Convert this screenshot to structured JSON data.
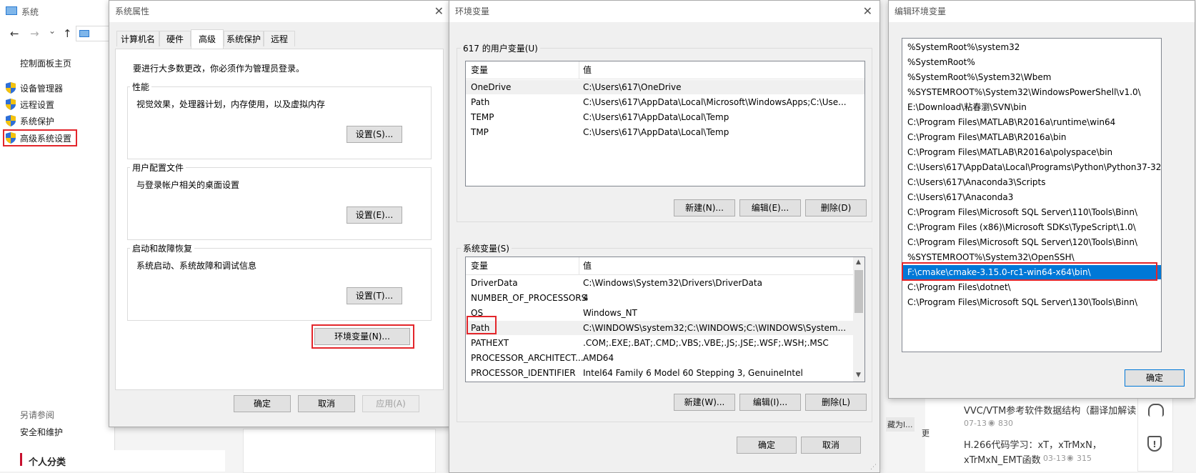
{
  "system_window": {
    "title": "系统",
    "nav_back": "←",
    "nav_forward": "→",
    "nav_dropdown": "⌄",
    "nav_up": "↑",
    "control_panel_home": "控制面板主页",
    "links": [
      {
        "label": "设备管理器"
      },
      {
        "label": "远程设置"
      },
      {
        "label": "系统保护"
      },
      {
        "label": "高级系统设置"
      }
    ],
    "see_also": "另请参阅",
    "security_maintenance": "安全和维护",
    "personal_category": "个人分类"
  },
  "sysprops": {
    "title": "系统属性",
    "close": "✕",
    "tabs": [
      "计算机名",
      "硬件",
      "高级",
      "系统保护",
      "远程"
    ],
    "admin_note": "要进行大多数更改，你必须作为管理员登录。",
    "perf_label": "性能",
    "perf_desc": "视觉效果，处理器计划，内存使用，以及虚拟内存",
    "perf_btn": "设置(S)...",
    "profile_label": "用户配置文件",
    "profile_desc": "与登录帐户相关的桌面设置",
    "profile_btn": "设置(E)...",
    "startup_label": "启动和故障恢复",
    "startup_desc": "系统启动、系统故障和调试信息",
    "startup_btn": "设置(T)...",
    "env_btn": "环境变量(N)...",
    "ok": "确定",
    "cancel": "取消",
    "apply": "应用(A)"
  },
  "envvars": {
    "title": "环境变量",
    "close": "✕",
    "user_group": "617 的用户变量(U)",
    "col_var": "变量",
    "col_val": "值",
    "user_vars": [
      {
        "name": "OneDrive",
        "value": "C:\\Users\\617\\OneDrive"
      },
      {
        "name": "Path",
        "value": "C:\\Users\\617\\AppData\\Local\\Microsoft\\WindowsApps;C:\\Use..."
      },
      {
        "name": "TEMP",
        "value": "C:\\Users\\617\\AppData\\Local\\Temp"
      },
      {
        "name": "TMP",
        "value": "C:\\Users\\617\\AppData\\Local\\Temp"
      }
    ],
    "user_new": "新建(N)...",
    "user_edit": "编辑(E)...",
    "user_delete": "删除(D)",
    "sys_group": "系统变量(S)",
    "sys_vars": [
      {
        "name": "DriverData",
        "value": "C:\\Windows\\System32\\Drivers\\DriverData"
      },
      {
        "name": "NUMBER_OF_PROCESSORS",
        "value": "4"
      },
      {
        "name": "OS",
        "value": "Windows_NT"
      },
      {
        "name": "Path",
        "value": "C:\\WINDOWS\\system32;C:\\WINDOWS;C:\\WINDOWS\\System..."
      },
      {
        "name": "PATHEXT",
        "value": ".COM;.EXE;.BAT;.CMD;.VBS;.VBE;.JS;.JSE;.WSF;.WSH;.MSC"
      },
      {
        "name": "PROCESSOR_ARCHITECT...",
        "value": "AMD64"
      },
      {
        "name": "PROCESSOR_IDENTIFIER",
        "value": "Intel64 Family 6 Model 60 Stepping 3, GenuineIntel"
      }
    ],
    "sys_new": "新建(W)...",
    "sys_edit": "编辑(I)...",
    "sys_delete": "删除(L)",
    "ok": "确定",
    "cancel": "取消"
  },
  "editenv": {
    "title": "编辑环境变量",
    "entries": [
      "%SystemRoot%\\system32",
      "%SystemRoot%",
      "%SystemRoot%\\System32\\Wbem",
      "%SYSTEMROOT%\\System32\\WindowsPowerShell\\v1.0\\",
      "E:\\Download\\粘春瀏\\SVN\\bin",
      "C:\\Program Files\\MATLAB\\R2016a\\runtime\\win64",
      "C:\\Program Files\\MATLAB\\R2016a\\bin",
      "C:\\Program Files\\MATLAB\\R2016a\\polyspace\\bin",
      "C:\\Users\\617\\AppData\\Local\\Programs\\Python\\Python37-32",
      "C:\\Users\\617\\Anaconda3\\Scripts",
      "C:\\Users\\617\\Anaconda3",
      "C:\\Program Files\\Microsoft SQL Server\\110\\Tools\\Binn\\",
      "C:\\Program Files (x86)\\Microsoft SDKs\\TypeScript\\1.0\\",
      "C:\\Program Files\\Microsoft SQL Server\\120\\Tools\\Binn\\",
      "%SYSTEMROOT%\\System32\\OpenSSH\\",
      "F:\\cmake\\cmake-3.15.0-rc1-win64-x64\\bin\\",
      "C:\\Program Files\\dotnet\\",
      "C:\\Program Files\\Microsoft SQL Server\\130\\Tools\\Binn\\"
    ],
    "ok": "确定"
  },
  "background": {
    "article1_title": "VVC/VTM参考软件数据结构（翻译加解读",
    "article1_date": "07-13",
    "article1_views": "830",
    "article2_title_line1": "H.266代码学习：xT，xTrMxN，",
    "article2_title_line2": "xTrMxN_EMT函数",
    "article2_date": "03-13",
    "article2_views": "315",
    "snippet": "藏为l...",
    "snippet2": "更"
  }
}
